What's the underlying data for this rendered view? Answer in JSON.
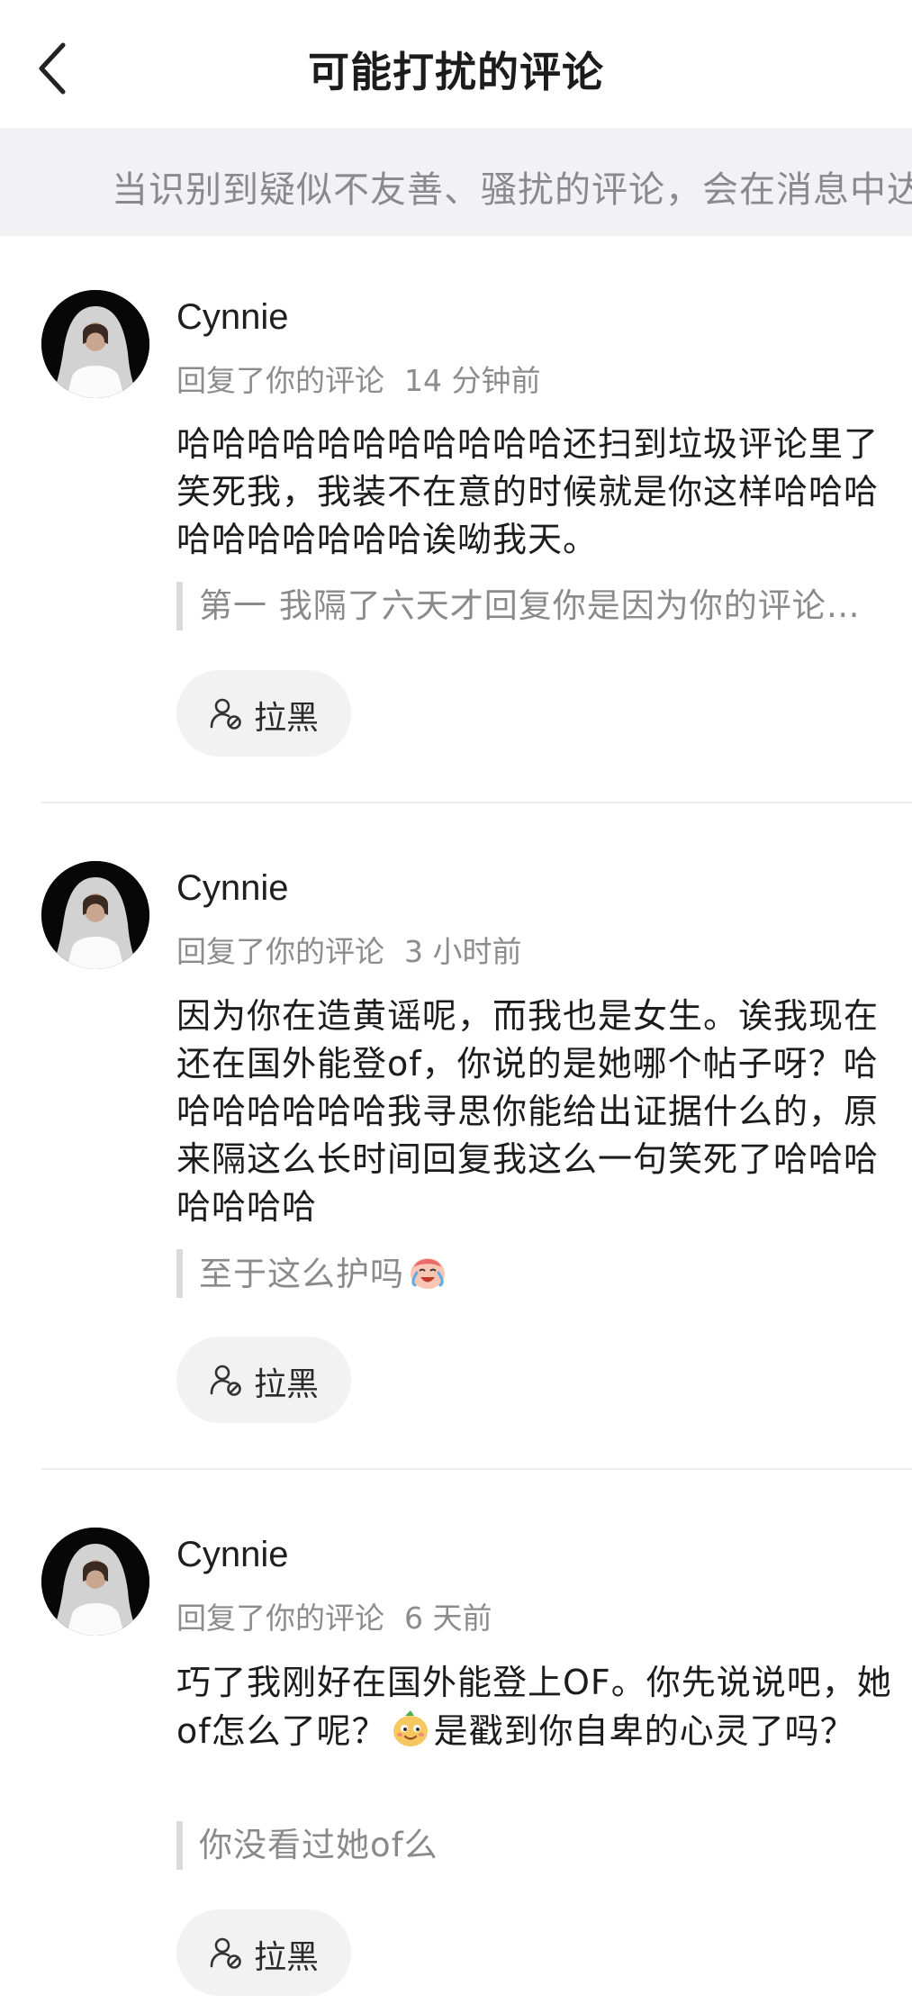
{
  "header": {
    "back_icon": "chevron-left-icon",
    "title": "可能打扰的评论"
  },
  "notice": {
    "text": "当识别到疑似不友善、骚扰的评论，会在消息中达"
  },
  "comments": [
    {
      "username": "Cynnie",
      "action": "回复了你的评论",
      "time": "14 分钟前",
      "body": "哈哈哈哈哈哈哈哈哈哈哈还扫到垃圾评论里了笑死我，我装不在意的时候就是你这样哈哈哈哈哈哈哈哈哈哈诶呦我天。",
      "quote": "第一 我隔了六天才回复你是因为你的评论被扫到垃圾评论里了",
      "block_label": "拉黑"
    },
    {
      "username": "Cynnie",
      "action": "回复了你的评论",
      "time": "3 小时前",
      "body": "因为你在造黄谣呢，而我也是女生。诶我现在还在国外能登of，你说的是她哪个帖子呀？哈哈哈哈哈哈哈我寻思你能给出证据什么的，原来隔这么长时间回复我这么一句笑死了哈哈哈哈哈哈哈",
      "quote": "至于这么护吗",
      "quote_emoji": "crying-laughing-emoji-icon",
      "block_label": "拉黑"
    },
    {
      "username": "Cynnie",
      "action": "回复了你的评论",
      "time": "6 天前",
      "body_before_emoji": "巧了我刚好在国外能登上OF。你先说说吧，她of怎么了呢？",
      "body_emoji": "sly-face-emoji-icon",
      "body_after_emoji": "是戳到你自卑的心灵了吗？",
      "quote": "你没看过她of么",
      "block_label": "拉黑"
    }
  ],
  "colors": {
    "background": "#ffffff",
    "notice_bg": "#f2f2f4",
    "button_bg": "#f2f2f2",
    "secondary_text": "#8c8c8c"
  }
}
